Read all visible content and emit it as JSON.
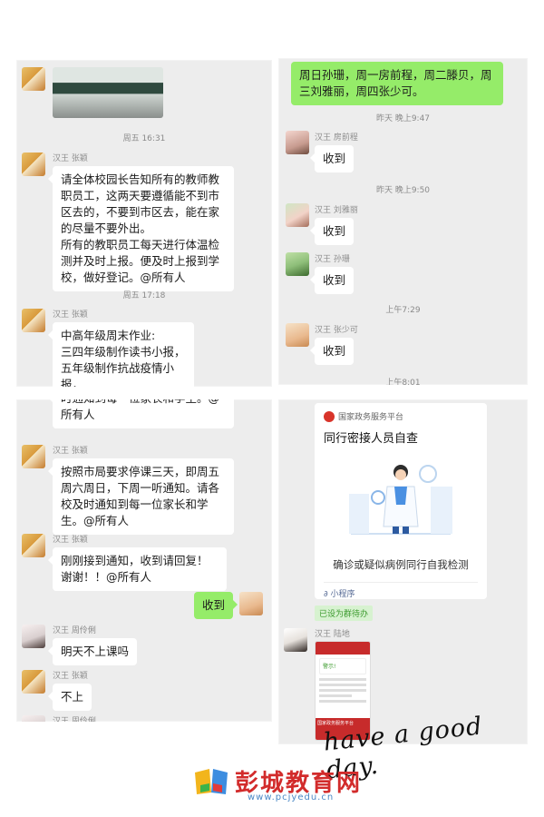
{
  "panel1": {
    "ts1": "周五 16:31",
    "msg1_sender": "汉王 张颖",
    "msg1_text": "请全体校园长告知所有的教师教职员工，这两天要遵循能不到市区去的，不要到市区去，能在家的尽量不要外出。\n所有的教职员工每天进行体温检测并及时上报。便及时上报到学校，做好登记。@所有人",
    "ts2": "周五 17:18",
    "msg2_sender": "汉王 张颖",
    "msg2_text": "中高年级周末作业:\n三四年级制作读书小报，\n五年级制作抗战疫情小报，\n六年级制作跳绳小报。"
  },
  "panel2": {
    "top_text": "周日孙珊，周一房前程，周二滕贝，周三刘雅丽，周四张少可。",
    "ts1": "昨天 晚上9:47",
    "m1_sender": "汉王 房前程",
    "m1_text": "收到",
    "ts2": "昨天 晚上9:50",
    "m2_sender": "汉王 刘雅丽",
    "m2_text": "收到",
    "m3_sender": "汉王 孙珊",
    "m3_text": "收到",
    "ts3": "上午7:29",
    "m4_sender": "汉王 张少可",
    "m4_text": "收到",
    "ts4": "上午8:01"
  },
  "panel3": {
    "cut_text": "时通知到每一位家长和学生。@所有人",
    "m1_sender": "汉王 张颖",
    "m1_text": "按照市局要求停课三天，即周五周六周日，下周一听通知。请各校及时通知到每一位家长和学生。@所有人",
    "m2_sender": "汉王 张颖",
    "m2_text": "刚刚接到通知，收到请回复！谢谢！！@所有人",
    "my_text": "收到",
    "m3_sender": "汉王 周伶俐",
    "m3_text": "明天不上课吗",
    "m4_sender": "汉王 张颖",
    "m4_text": "不上",
    "m5_sender": "汉王 周伶俐"
  },
  "panel4": {
    "card_org": "国家政务服务平台",
    "card_title": "同行密接人员自查",
    "card_desc": "确诊或疑似病例同行自我检测",
    "card_mini": "小程序",
    "pinned": "已设为群待办",
    "m_sender": "汉王 陆地",
    "phone_header": "警示!",
    "phone_footer": "国家政务服务平台"
  },
  "handwriting": "have a good day.",
  "brand": "彭城教育网",
  "url": "www.pcjyedu.cn"
}
